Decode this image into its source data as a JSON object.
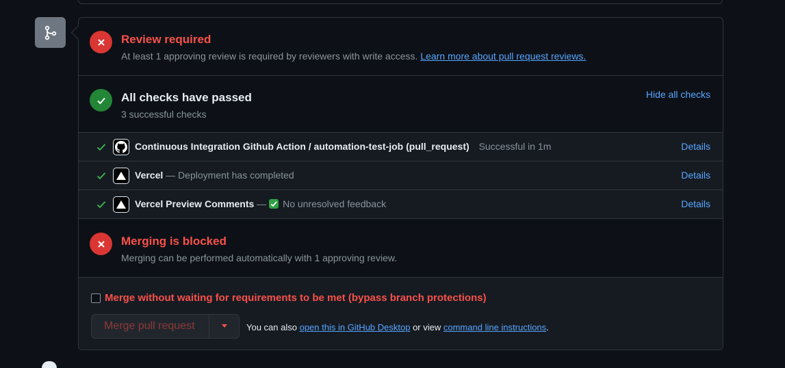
{
  "review": {
    "title": "Review required",
    "text": "At least 1 approving review is required by reviewers with write access.",
    "link": "Learn more about pull request reviews."
  },
  "checks": {
    "title": "All checks have passed",
    "subtitle": "3 successful checks",
    "hide_label": "Hide all checks",
    "rows": [
      {
        "name": "Continuous Integration Github Action / automation-test-job (pull_request)",
        "sep": "",
        "desc": "Successful in 1m",
        "details": "Details",
        "avatar": "github-icon"
      },
      {
        "name": "Vercel",
        "sep": " — ",
        "desc": "Deployment has completed",
        "details": "Details",
        "avatar": "vercel-icon"
      },
      {
        "name": "Vercel Preview Comments",
        "sep": " — ",
        "desc": "No unresolved feedback",
        "details": "Details",
        "avatar": "vercel-icon"
      }
    ]
  },
  "blocked": {
    "title": "Merging is blocked",
    "text": "Merging can be performed automatically with 1 approving review."
  },
  "merge": {
    "bypass_label": "Merge without waiting for requirements to be met (bypass branch protections)",
    "button_label": "Merge pull request",
    "also_prefix": "You can also ",
    "desktop_link": "open this in GitHub Desktop",
    "or_view": " or view ",
    "cli_link": "command line instructions",
    "suffix": "."
  },
  "colors": {
    "error": "#f85149",
    "success": "#238636",
    "link": "#58a6ff",
    "background": "#0d1117"
  }
}
